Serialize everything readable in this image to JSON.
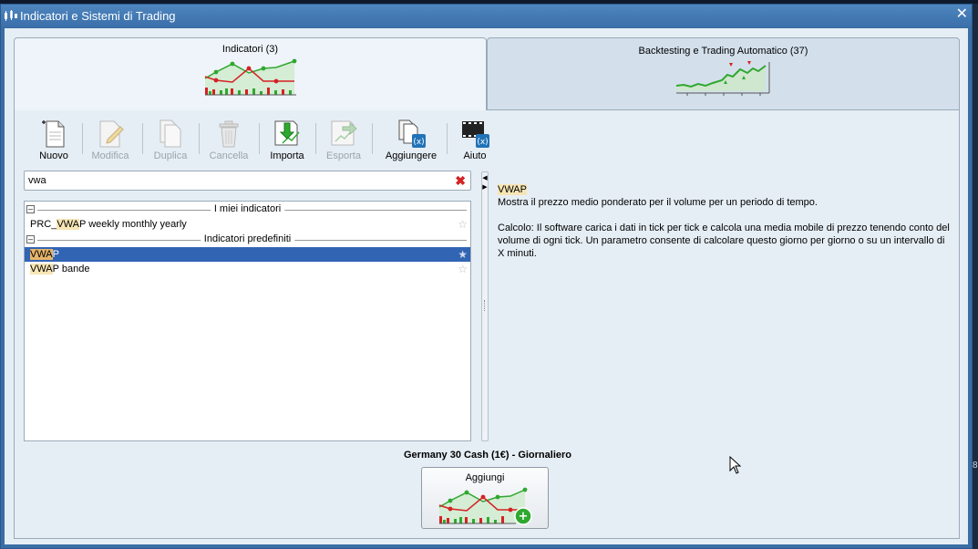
{
  "window": {
    "title": "Indicatori e Sistemi di Trading",
    "close_glyph": "✕"
  },
  "tabs": [
    {
      "label": "Indicatori (3)",
      "active": true
    },
    {
      "label": "Backtesting e Trading Automatico (37)",
      "active": false
    }
  ],
  "toolbar": {
    "nuovo": "Nuovo",
    "modifica": "Modifica",
    "duplica": "Duplica",
    "cancella": "Cancella",
    "importa": "Importa",
    "esporta": "Esporta",
    "aggiungere": "Aggiungere",
    "aiuto": "Aiuto"
  },
  "search": {
    "value": "vwa",
    "clear_glyph": "✖"
  },
  "list": {
    "group1": {
      "toggle": "–",
      "title": "I miei indicatori"
    },
    "group1_items": [
      {
        "pre": "PRC_",
        "hl": "VWA",
        "post": "P weekly monthly yearly"
      }
    ],
    "group2": {
      "toggle": "–",
      "title": "Indicatori predefiniti"
    },
    "group2_items": [
      {
        "pre": "",
        "hl": "VWA",
        "post": "P",
        "selected": true
      },
      {
        "pre": "",
        "hl": "VWA",
        "post": "P bande",
        "selected": false
      }
    ],
    "star_glyph": "☆",
    "star_selected_glyph": "★"
  },
  "description": {
    "name": "VWAP",
    "summary": "Mostra il prezzo medio ponderato per il volume per un periodo di tempo.",
    "detail": "Calcolo: Il software carica i dati in tick per tick e calcola una media mobile di prezzo tenendo conto del volume di ogni tick. Un parametro consente di calcolare questo giorno per giorno o su un intervallo di X minuti."
  },
  "instrument": "Germany 30 Cash (1€) - Giornaliero",
  "add_button": {
    "label": "Aggiungi",
    "plus_glyph": "+"
  },
  "edge_text": "8",
  "colors": {
    "accent": "#3264b4",
    "highlight": "#f7e6b5",
    "green_line": "#2fa82f",
    "red_line": "#d42222",
    "window_blue": "#3a6ea5"
  },
  "icons": {
    "nuovo": "new-document-icon",
    "modifica": "edit-document-icon",
    "duplica": "duplicate-icon",
    "cancella": "trash-icon",
    "importa": "import-icon",
    "esporta": "export-icon",
    "aggiungere": "add-to-chart-icon",
    "aiuto": "video-help-icon"
  }
}
